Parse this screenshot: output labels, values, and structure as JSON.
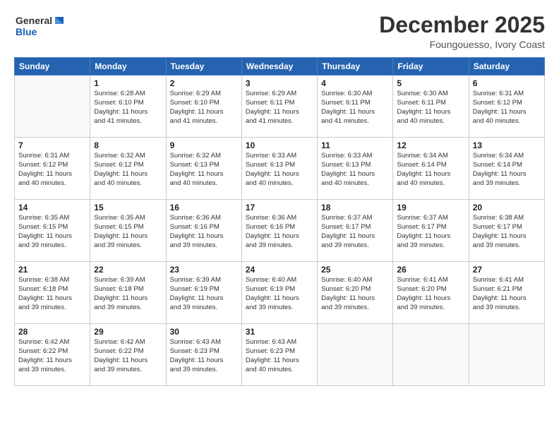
{
  "header": {
    "logo_line1": "General",
    "logo_line2": "Blue",
    "month": "December 2025",
    "location": "Foungouesso, Ivory Coast"
  },
  "weekdays": [
    "Sunday",
    "Monday",
    "Tuesday",
    "Wednesday",
    "Thursday",
    "Friday",
    "Saturday"
  ],
  "weeks": [
    [
      {
        "day": "",
        "info": ""
      },
      {
        "day": "1",
        "info": "Sunrise: 6:28 AM\nSunset: 6:10 PM\nDaylight: 11 hours\nand 41 minutes."
      },
      {
        "day": "2",
        "info": "Sunrise: 6:29 AM\nSunset: 6:10 PM\nDaylight: 11 hours\nand 41 minutes."
      },
      {
        "day": "3",
        "info": "Sunrise: 6:29 AM\nSunset: 6:11 PM\nDaylight: 11 hours\nand 41 minutes."
      },
      {
        "day": "4",
        "info": "Sunrise: 6:30 AM\nSunset: 6:11 PM\nDaylight: 11 hours\nand 41 minutes."
      },
      {
        "day": "5",
        "info": "Sunrise: 6:30 AM\nSunset: 6:11 PM\nDaylight: 11 hours\nand 40 minutes."
      },
      {
        "day": "6",
        "info": "Sunrise: 6:31 AM\nSunset: 6:12 PM\nDaylight: 11 hours\nand 40 minutes."
      }
    ],
    [
      {
        "day": "7",
        "info": "Sunrise: 6:31 AM\nSunset: 6:12 PM\nDaylight: 11 hours\nand 40 minutes."
      },
      {
        "day": "8",
        "info": "Sunrise: 6:32 AM\nSunset: 6:12 PM\nDaylight: 11 hours\nand 40 minutes."
      },
      {
        "day": "9",
        "info": "Sunrise: 6:32 AM\nSunset: 6:13 PM\nDaylight: 11 hours\nand 40 minutes."
      },
      {
        "day": "10",
        "info": "Sunrise: 6:33 AM\nSunset: 6:13 PM\nDaylight: 11 hours\nand 40 minutes."
      },
      {
        "day": "11",
        "info": "Sunrise: 6:33 AM\nSunset: 6:13 PM\nDaylight: 11 hours\nand 40 minutes."
      },
      {
        "day": "12",
        "info": "Sunrise: 6:34 AM\nSunset: 6:14 PM\nDaylight: 11 hours\nand 40 minutes."
      },
      {
        "day": "13",
        "info": "Sunrise: 6:34 AM\nSunset: 6:14 PM\nDaylight: 11 hours\nand 39 minutes."
      }
    ],
    [
      {
        "day": "14",
        "info": "Sunrise: 6:35 AM\nSunset: 6:15 PM\nDaylight: 11 hours\nand 39 minutes."
      },
      {
        "day": "15",
        "info": "Sunrise: 6:35 AM\nSunset: 6:15 PM\nDaylight: 11 hours\nand 39 minutes."
      },
      {
        "day": "16",
        "info": "Sunrise: 6:36 AM\nSunset: 6:16 PM\nDaylight: 11 hours\nand 39 minutes."
      },
      {
        "day": "17",
        "info": "Sunrise: 6:36 AM\nSunset: 6:16 PM\nDaylight: 11 hours\nand 39 minutes."
      },
      {
        "day": "18",
        "info": "Sunrise: 6:37 AM\nSunset: 6:17 PM\nDaylight: 11 hours\nand 39 minutes."
      },
      {
        "day": "19",
        "info": "Sunrise: 6:37 AM\nSunset: 6:17 PM\nDaylight: 11 hours\nand 39 minutes."
      },
      {
        "day": "20",
        "info": "Sunrise: 6:38 AM\nSunset: 6:17 PM\nDaylight: 11 hours\nand 39 minutes."
      }
    ],
    [
      {
        "day": "21",
        "info": "Sunrise: 6:38 AM\nSunset: 6:18 PM\nDaylight: 11 hours\nand 39 minutes."
      },
      {
        "day": "22",
        "info": "Sunrise: 6:39 AM\nSunset: 6:18 PM\nDaylight: 11 hours\nand 39 minutes."
      },
      {
        "day": "23",
        "info": "Sunrise: 6:39 AM\nSunset: 6:19 PM\nDaylight: 11 hours\nand 39 minutes."
      },
      {
        "day": "24",
        "info": "Sunrise: 6:40 AM\nSunset: 6:19 PM\nDaylight: 11 hours\nand 39 minutes."
      },
      {
        "day": "25",
        "info": "Sunrise: 6:40 AM\nSunset: 6:20 PM\nDaylight: 11 hours\nand 39 minutes."
      },
      {
        "day": "26",
        "info": "Sunrise: 6:41 AM\nSunset: 6:20 PM\nDaylight: 11 hours\nand 39 minutes."
      },
      {
        "day": "27",
        "info": "Sunrise: 6:41 AM\nSunset: 6:21 PM\nDaylight: 11 hours\nand 39 minutes."
      }
    ],
    [
      {
        "day": "28",
        "info": "Sunrise: 6:42 AM\nSunset: 6:22 PM\nDaylight: 11 hours\nand 39 minutes."
      },
      {
        "day": "29",
        "info": "Sunrise: 6:42 AM\nSunset: 6:22 PM\nDaylight: 11 hours\nand 39 minutes."
      },
      {
        "day": "30",
        "info": "Sunrise: 6:43 AM\nSunset: 6:23 PM\nDaylight: 11 hours\nand 39 minutes."
      },
      {
        "day": "31",
        "info": "Sunrise: 6:43 AM\nSunset: 6:23 PM\nDaylight: 11 hours\nand 40 minutes."
      },
      {
        "day": "",
        "info": ""
      },
      {
        "day": "",
        "info": ""
      },
      {
        "day": "",
        "info": ""
      }
    ]
  ]
}
